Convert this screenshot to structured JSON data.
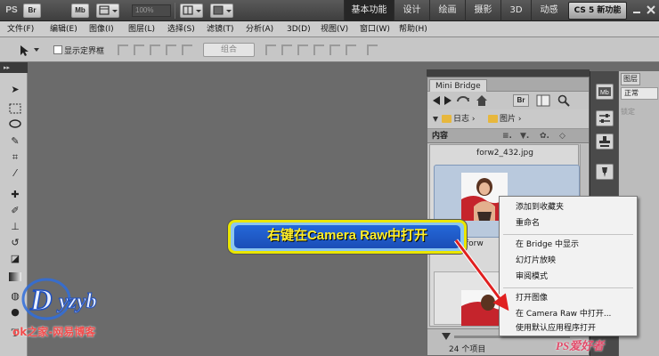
{
  "appbar": {
    "logo": "PS",
    "br_label": "Br",
    "mb_label": "Mb",
    "zoom": "100%",
    "workspaces": [
      "基本功能",
      "设计",
      "绘画",
      "摄影",
      "3D",
      "动感"
    ],
    "cs5_button": "CS 5 新功能"
  },
  "menubar": {
    "items": [
      "文件(F)",
      "编辑(E)",
      "图像(I)",
      "图层(L)",
      "选择(S)",
      "滤镜(T)",
      "分析(A)",
      "3D(D)",
      "视图(V)",
      "窗口(W)",
      "帮助(H)"
    ]
  },
  "options": {
    "show_bounds_label": "显示定界框",
    "group_label": "组合"
  },
  "mini_bridge": {
    "tab_label": "Mini Bridge",
    "path": [
      "日志",
      "图片"
    ],
    "content_label": "内容",
    "filename": "forw2_432.jpg",
    "partial_filename": "forw",
    "item_count": "24 个项目"
  },
  "layers_panel": {
    "tab_label": "图层",
    "mode": "正常",
    "lock_label": "锁定"
  },
  "context_menu": {
    "items": [
      "添加到收藏夹",
      "重命名",
      "在 Bridge 中显示",
      "幻灯片放映",
      "审阅模式",
      "打开图像",
      "在 Camera Raw 中打开...",
      "使用默认应用程序打开"
    ]
  },
  "callout": {
    "text": "右键在Camera Raw中打开",
    "colors": {
      "text": "#ffef2a",
      "fill": "#1f5bc8",
      "border": "#eae600",
      "arrow": "#e02020"
    }
  },
  "watermark": {
    "logo_text": "Dyzyb",
    "caption": "ok之家-网易博客",
    "site": "PS爱好者"
  }
}
